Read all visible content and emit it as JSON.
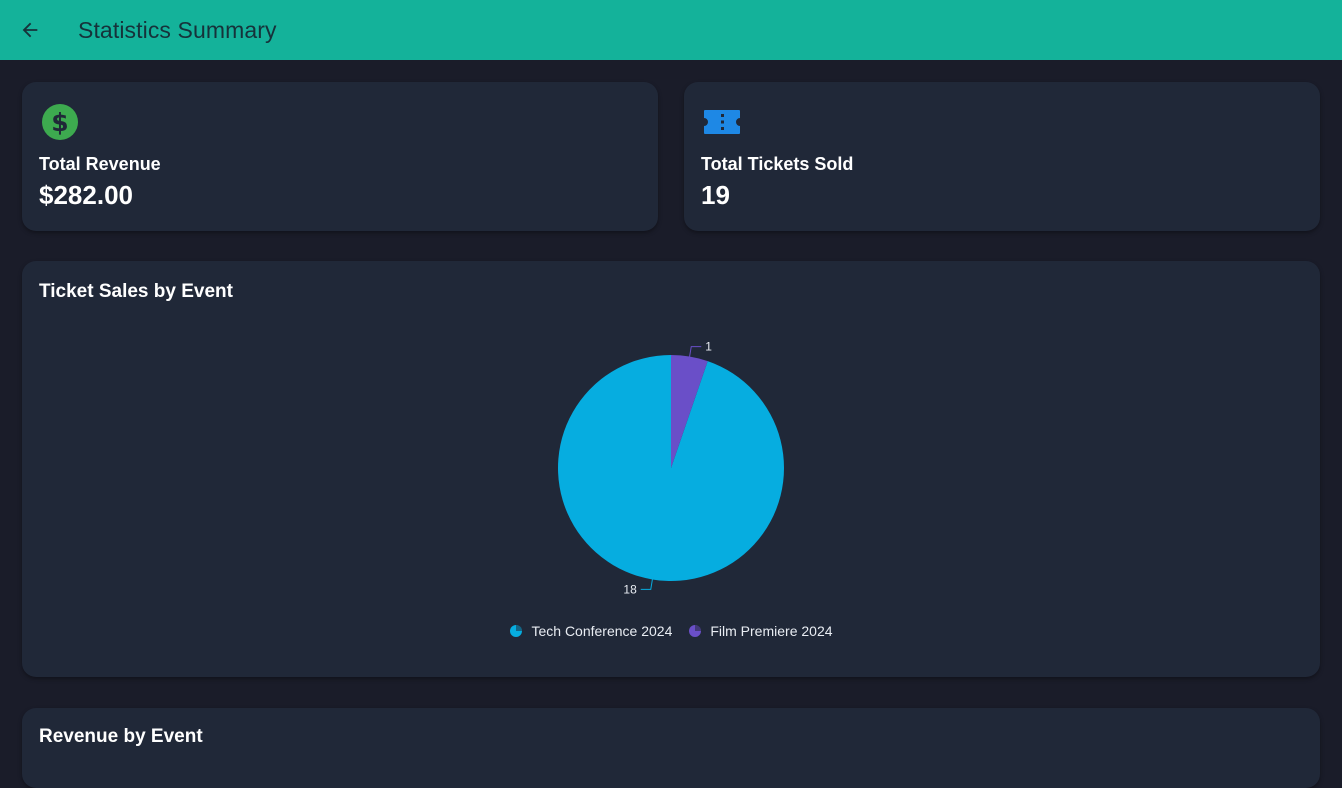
{
  "appbar": {
    "title": "Statistics Summary",
    "back_icon": "arrow-back-icon",
    "color": "#14b29a"
  },
  "stats": {
    "revenue": {
      "label": "Total Revenue",
      "value": "$282.00",
      "icon": "dollar-circle-icon",
      "icon_color": "#3daa4f"
    },
    "tickets": {
      "label": "Total Tickets Sold",
      "value": "19",
      "icon": "ticket-icon",
      "icon_color": "#1e88e5"
    }
  },
  "chart_card": {
    "title": "Ticket Sales by Event"
  },
  "chart_data": {
    "type": "pie",
    "title": "Ticket Sales by Event",
    "categories": [
      "Tech Conference 2024",
      "Film Premiere 2024"
    ],
    "values": [
      18,
      1
    ],
    "colors": [
      "#06ade0",
      "#6a4fc8"
    ],
    "data_labels": [
      "18",
      "1"
    ],
    "legend_position": "bottom"
  },
  "bottom_card": {
    "title": "Revenue by Event"
  }
}
